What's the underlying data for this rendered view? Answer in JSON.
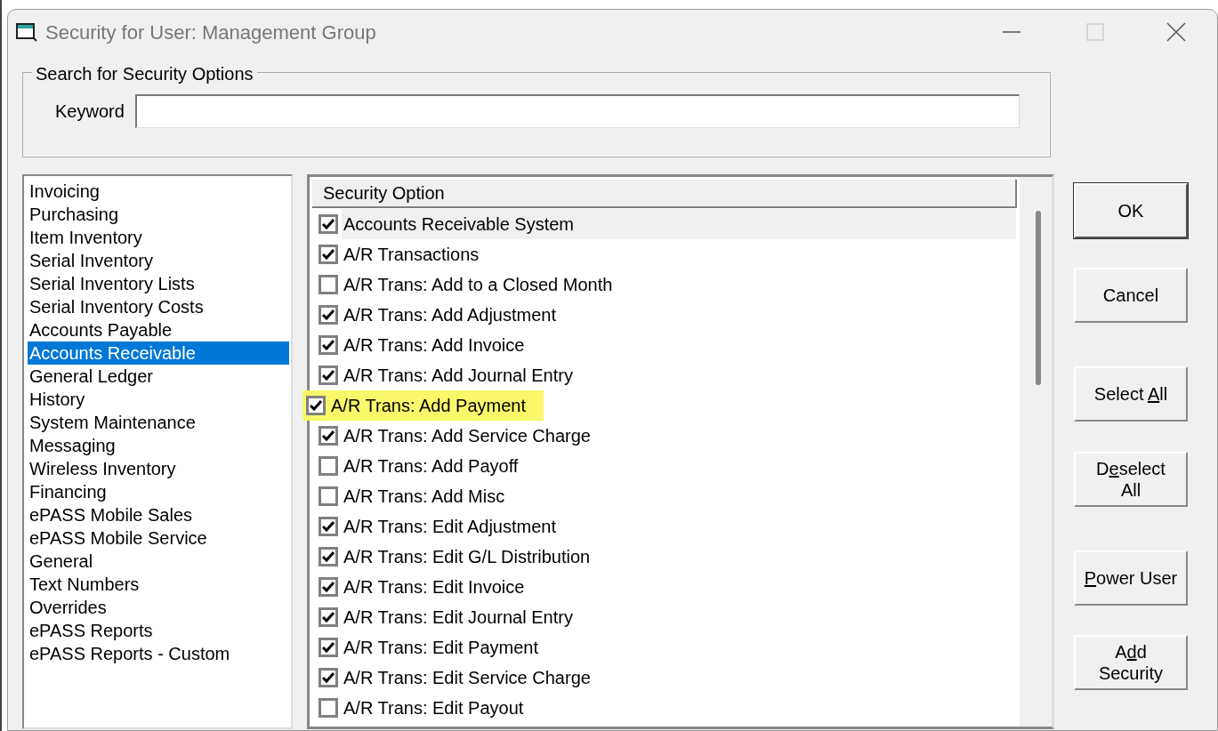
{
  "window": {
    "title": "Security for User: Management Group"
  },
  "search": {
    "group_title": "Search for Security Options",
    "label": "Keyword"
  },
  "categories": [
    {
      "label": "Invoicing",
      "selected": false
    },
    {
      "label": "Purchasing",
      "selected": false
    },
    {
      "label": "Item Inventory",
      "selected": false
    },
    {
      "label": "Serial Inventory",
      "selected": false
    },
    {
      "label": "Serial Inventory Lists",
      "selected": false
    },
    {
      "label": "Serial Inventory Costs",
      "selected": false
    },
    {
      "label": "Accounts Payable",
      "selected": false
    },
    {
      "label": "Accounts Receivable",
      "selected": true
    },
    {
      "label": "General Ledger",
      "selected": false
    },
    {
      "label": "History",
      "selected": false
    },
    {
      "label": "System Maintenance",
      "selected": false
    },
    {
      "label": "Messaging",
      "selected": false
    },
    {
      "label": "Wireless Inventory",
      "selected": false
    },
    {
      "label": "Financing",
      "selected": false
    },
    {
      "label": "ePASS Mobile Sales",
      "selected": false
    },
    {
      "label": "ePASS Mobile Service",
      "selected": false
    },
    {
      "label": "General",
      "selected": false
    },
    {
      "label": "Text Numbers",
      "selected": false
    },
    {
      "label": "Overrides",
      "selected": false
    },
    {
      "label": "ePASS Reports",
      "selected": false
    },
    {
      "label": "ePASS Reports - Custom",
      "selected": false
    }
  ],
  "options": {
    "column_header": "Security Option",
    "rows": [
      {
        "label": "Accounts Receivable System",
        "checked": true,
        "selected": true,
        "highlighted": false
      },
      {
        "label": "A/R Transactions",
        "checked": true,
        "selected": false,
        "highlighted": false
      },
      {
        "label": "A/R Trans: Add to a Closed Month",
        "checked": false,
        "selected": false,
        "highlighted": false
      },
      {
        "label": "A/R Trans: Add Adjustment",
        "checked": true,
        "selected": false,
        "highlighted": false
      },
      {
        "label": "A/R Trans: Add Invoice",
        "checked": true,
        "selected": false,
        "highlighted": false
      },
      {
        "label": "A/R Trans: Add Journal Entry",
        "checked": true,
        "selected": false,
        "highlighted": false
      },
      {
        "label": "A/R Trans: Add Payment",
        "checked": true,
        "selected": false,
        "highlighted": true
      },
      {
        "label": "A/R Trans: Add Service Charge",
        "checked": true,
        "selected": false,
        "highlighted": false
      },
      {
        "label": "A/R Trans: Add Payoff",
        "checked": false,
        "selected": false,
        "highlighted": false
      },
      {
        "label": "A/R Trans: Add Misc",
        "checked": false,
        "selected": false,
        "highlighted": false
      },
      {
        "label": "A/R Trans: Edit Adjustment",
        "checked": true,
        "selected": false,
        "highlighted": false
      },
      {
        "label": "A/R Trans: Edit G/L Distribution",
        "checked": true,
        "selected": false,
        "highlighted": false
      },
      {
        "label": "A/R Trans: Edit Invoice",
        "checked": true,
        "selected": false,
        "highlighted": false
      },
      {
        "label": "A/R Trans: Edit Journal Entry",
        "checked": true,
        "selected": false,
        "highlighted": false
      },
      {
        "label": "A/R Trans: Edit Payment",
        "checked": true,
        "selected": false,
        "highlighted": false
      },
      {
        "label": "A/R Trans: Edit Service Charge",
        "checked": true,
        "selected": false,
        "highlighted": false
      },
      {
        "label": "A/R Trans: Edit Payout",
        "checked": false,
        "selected": false,
        "highlighted": false
      }
    ]
  },
  "buttons": [
    {
      "label_after": "OK",
      "default": true
    },
    {
      "label_after": "Cancel",
      "default": false
    },
    {
      "label_before": "Select ",
      "hotkey": "A",
      "label_after": "ll",
      "default": false
    },
    {
      "label_before": "D",
      "hotkey": "e",
      "label_after": "select",
      "label_line2": "All",
      "default": false
    },
    {
      "hotkey": "P",
      "label_after": "ower User",
      "default": false
    },
    {
      "label_before": "A",
      "hotkey": "d",
      "label_after": "d",
      "label_line2": "Security",
      "default": false
    }
  ]
}
